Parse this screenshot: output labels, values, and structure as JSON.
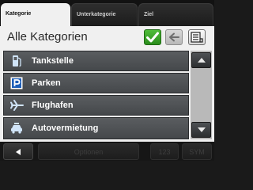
{
  "tabs": [
    {
      "label": "Kategorie",
      "active": true
    },
    {
      "label": "Unterkategorie",
      "active": false
    },
    {
      "label": "Ziel",
      "active": false
    }
  ],
  "header": {
    "title": "Alle Kategorien"
  },
  "toolbar": {
    "confirm_icon": "checkmark-icon",
    "back_icon": "arrow-left-icon",
    "list_icon": "list-icon"
  },
  "categories": [
    {
      "label": "Tankstelle",
      "icon": "fuel-pump-icon"
    },
    {
      "label": "Parken",
      "icon": "parking-icon"
    },
    {
      "label": "Flughafen",
      "icon": "airplane-icon"
    },
    {
      "label": "Autovermietung",
      "icon": "car-rental-icon"
    }
  ],
  "bottom_bar": {
    "options_label": "Optionen",
    "numeric_label": "123",
    "symbols_label": "SYM"
  },
  "colors": {
    "confirm_green": "#3aa52a",
    "row_bg": "#505356",
    "panel_bg": "#f0f0f0"
  }
}
